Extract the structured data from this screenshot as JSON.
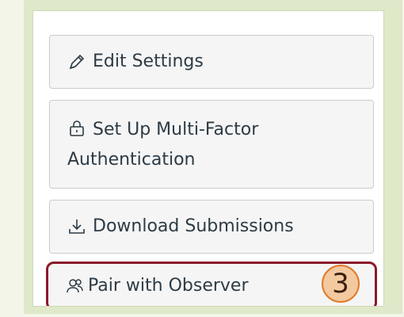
{
  "menu": {
    "edit_settings": "Edit Settings",
    "mfa_line1": "Set Up Multi-Factor",
    "mfa_line2": "Authentication",
    "download_submissions": "Download Submissions",
    "pair_with_observer": "Pair with Observer"
  },
  "callout": {
    "number": "3"
  },
  "colors": {
    "button_bg": "#f5f5f5",
    "button_border": "#c7cdd1",
    "highlight_border": "#8a1a2a",
    "callout_fill": "#f3c9a0",
    "callout_border": "#e07a2c",
    "frame_bg": "#dfe8c9"
  },
  "icons": [
    "pencil-icon",
    "lock-icon",
    "download-icon",
    "observer-icon"
  ]
}
